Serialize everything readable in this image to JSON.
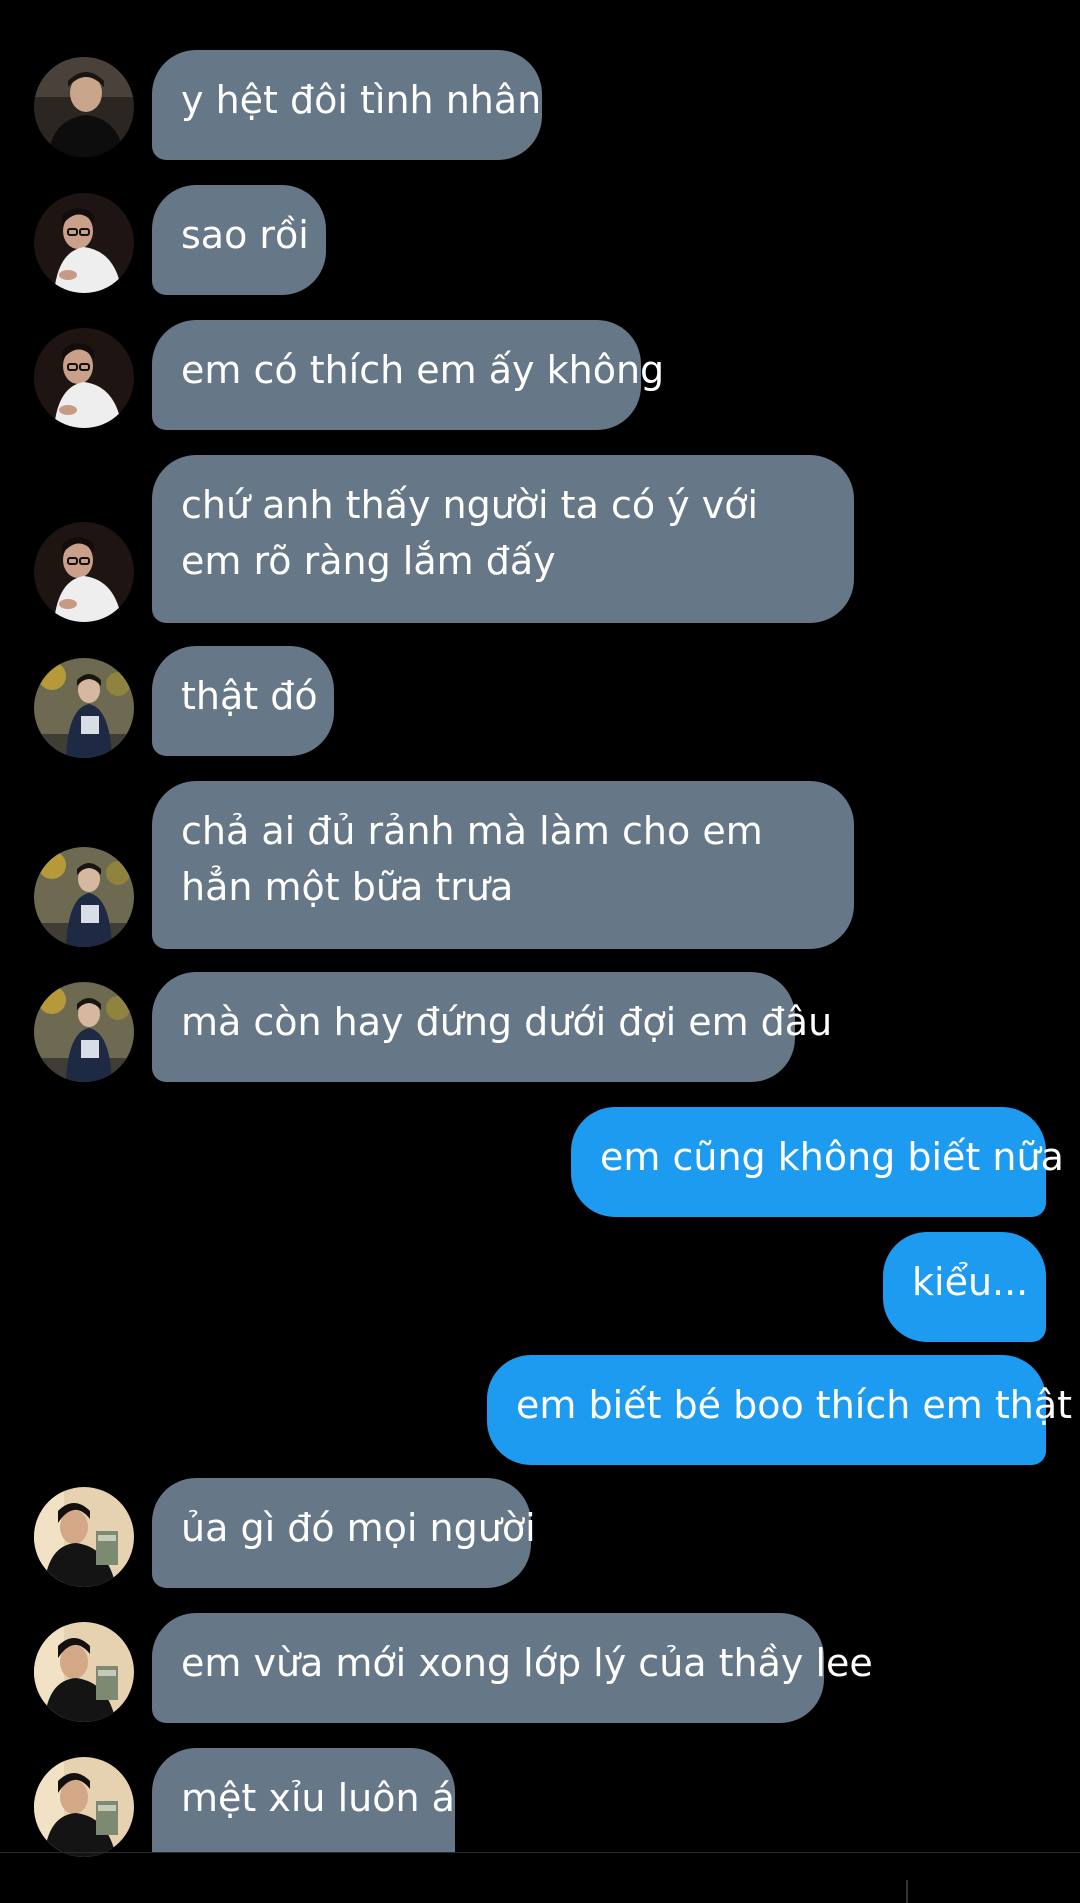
{
  "messages": [
    {
      "text": "y hệt đôi tình nhân",
      "avatar": "avatar-black-shirt"
    },
    {
      "text": "sao rồi",
      "avatar": "avatar-white-turtleneck"
    },
    {
      "text": "em có thích em ấy không",
      "avatar": "avatar-white-turtleneck"
    },
    {
      "text": "chứ anh thấy người ta có ý với em rõ ràng lắm đấy",
      "avatar": "avatar-white-turtleneck"
    },
    {
      "text": "thật đó",
      "avatar": "avatar-graphic-tee"
    },
    {
      "text": "chả ai đủ rảnh mà làm cho em hẳn một bữa trưa",
      "avatar": "avatar-graphic-tee"
    },
    {
      "text": "mà còn hay đứng dưới đợi em đâu",
      "avatar": "avatar-graphic-tee"
    },
    {
      "text": "em cũng không biết nữa"
    },
    {
      "text": "kiểu..."
    },
    {
      "text": "em biết bé boo thích em thật"
    },
    {
      "text": "ủa gì đó mọi người",
      "avatar": "avatar-reading-book"
    },
    {
      "text": "em vừa mới xong lớp lý của thầy lee",
      "avatar": "avatar-reading-book"
    },
    {
      "text": "mệt xỉu luôn á",
      "avatar": "avatar-reading-book"
    }
  ],
  "colors": {
    "background": "#000000",
    "incoming_bubble": "#667788",
    "outgoing_bubble": "#1d9bf0",
    "text": "#ffffff"
  }
}
